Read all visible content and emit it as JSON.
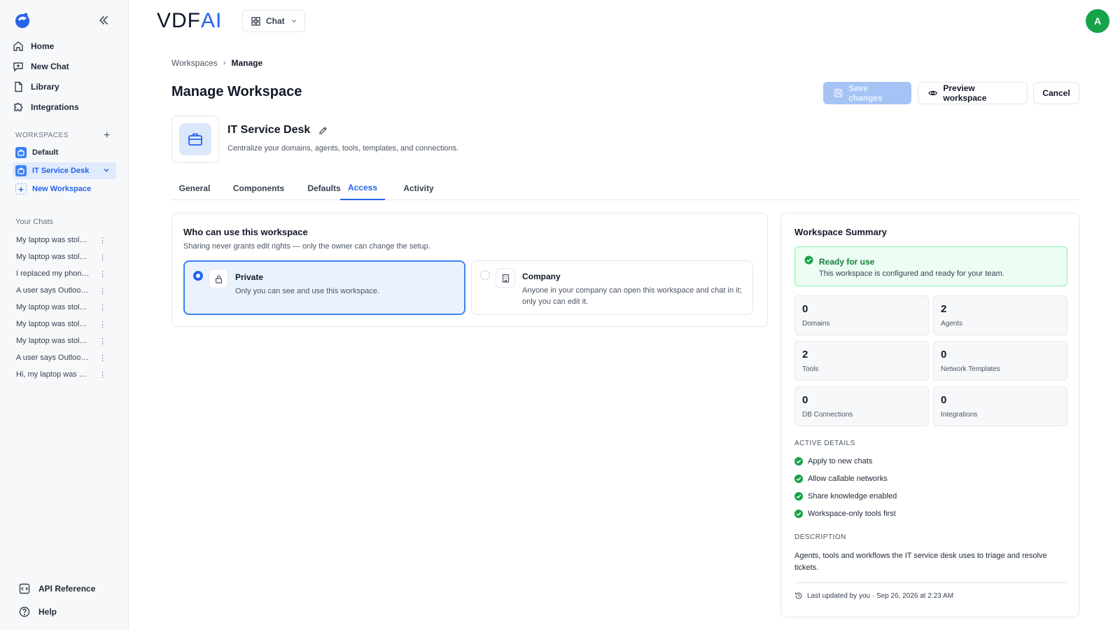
{
  "colors": {
    "accent": "#2563eb",
    "success": "#16a34a",
    "sidebar_bg": "#f7f8fa"
  },
  "sidebar": {
    "nav": [
      {
        "label": "Home",
        "icon": "home-icon"
      },
      {
        "label": "New Chat",
        "icon": "new-chat-icon"
      },
      {
        "label": "Library",
        "icon": "file-icon"
      },
      {
        "label": "Integrations",
        "icon": "puzzle-icon"
      }
    ],
    "workspaces_label": "WORKSPACES",
    "workspaces": [
      {
        "label": "Default"
      },
      {
        "label": "IT Service Desk",
        "active": true
      },
      {
        "label": "New Workspace"
      }
    ],
    "chats_label": "Your Chats",
    "chats": [
      "My laptop was stolen and I need help",
      "My laptop was stolen yesterday",
      "I replaced my phone and lost MFA",
      "A user says Outlook keeps crashing",
      "My laptop was stolen from my car",
      "My laptop was stolen at the airport",
      "My laptop was stolen this morning",
      "A user says Outlook won't open",
      "Hi, my laptop was stolen"
    ],
    "footer": {
      "api_reference": "API Reference",
      "help": "Help"
    }
  },
  "header": {
    "brand_main": "VDF",
    "brand_ai": "AI",
    "app_switch": "Chat",
    "avatar_initial": "A"
  },
  "breadcrumb": {
    "root": "Workspaces",
    "current": "Manage"
  },
  "page": {
    "title": "Manage Workspace",
    "save_label": "Save changes",
    "preview_label": "Preview workspace",
    "cancel_label": "Cancel"
  },
  "workspace": {
    "name": "IT Service Desk",
    "description": "Centralize your domains, agents, tools, templates, and connections."
  },
  "tabs": [
    "General",
    "Components",
    "Defaults",
    "Access",
    "Activity"
  ],
  "access": {
    "title": "Who can use this workspace",
    "subtitle": "Sharing never grants edit rights — only the owner can change the setup.",
    "options": [
      {
        "title": "Private",
        "desc": "Only you can see and use this workspace.",
        "selected": true
      },
      {
        "title": "Company",
        "desc": "Anyone in your company can open this workspace and chat in it; only you can edit it.",
        "selected": false
      }
    ]
  },
  "summary": {
    "title": "Workspace Summary",
    "ready_title": "Ready for use",
    "ready_sub": "This workspace is configured and ready for your team.",
    "stats": [
      {
        "value": "0",
        "label": "Domains"
      },
      {
        "value": "2",
        "label": "Agents"
      },
      {
        "value": "2",
        "label": "Tools"
      },
      {
        "value": "0",
        "label": "Network Templates"
      },
      {
        "value": "0",
        "label": "DB Connections"
      },
      {
        "value": "0",
        "label": "Integrations"
      }
    ],
    "active_label": "ACTIVE DETAILS",
    "details": [
      "Apply to new chats",
      "Allow callable networks",
      "Share knowledge enabled",
      "Workspace-only tools first"
    ],
    "description_label": "DESCRIPTION",
    "description": "Agents, tools and workflows the IT service desk uses to triage and resolve tickets.",
    "last_updated": "Last updated by you · Sep 26, 2026 at 2:23 AM"
  }
}
